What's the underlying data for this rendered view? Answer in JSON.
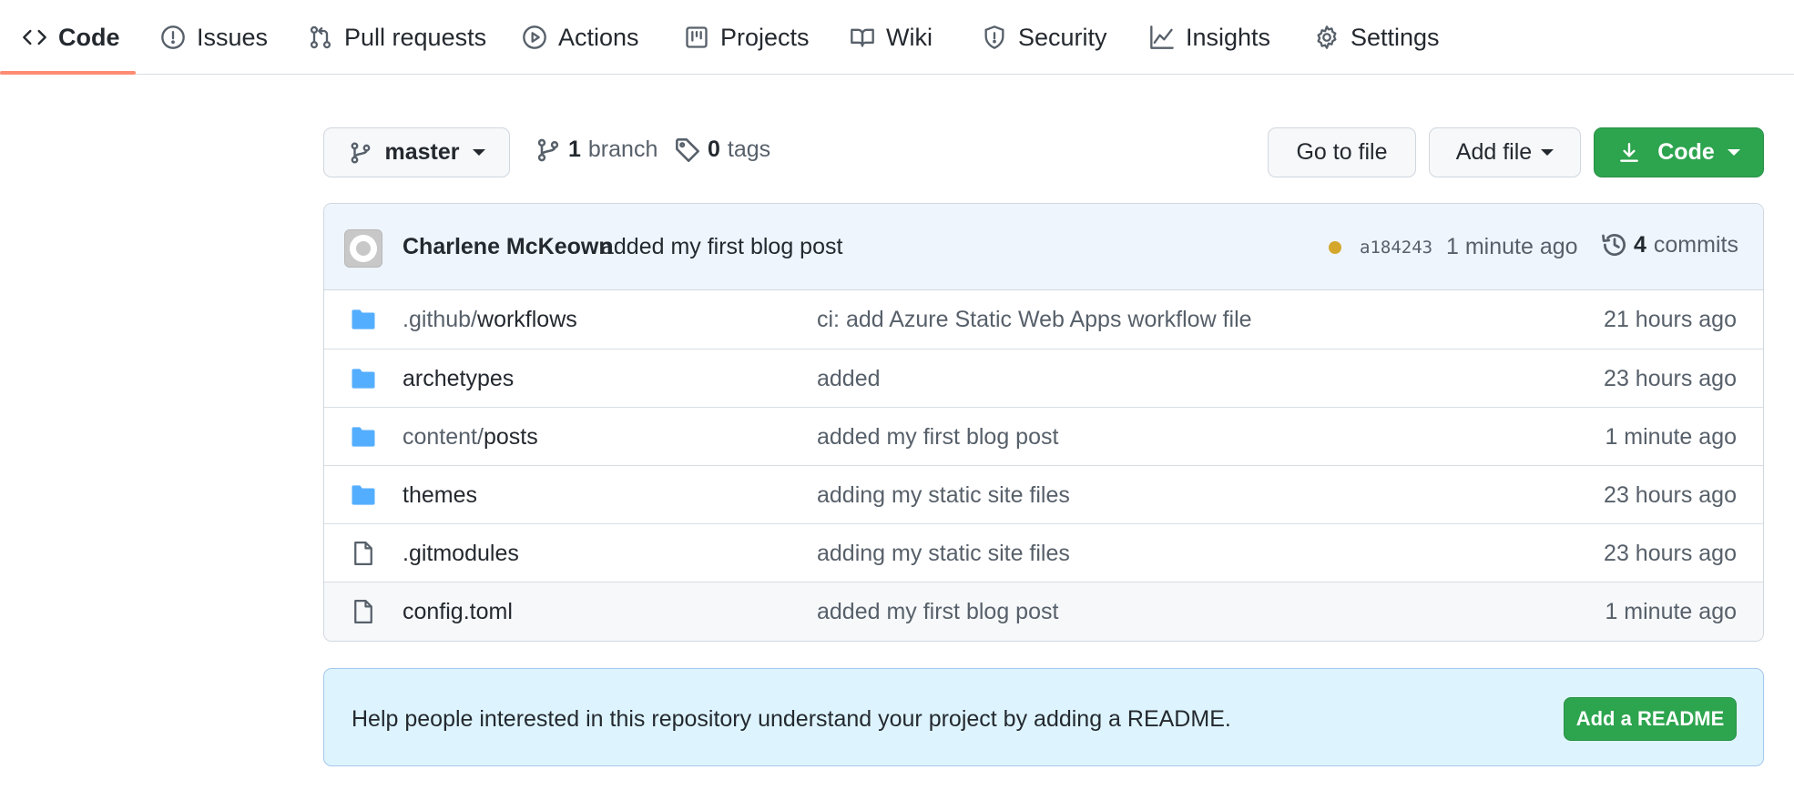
{
  "nav": {
    "tabs": [
      {
        "label": "Code",
        "icon": "code-icon",
        "active": true
      },
      {
        "label": "Issues",
        "icon": "issue-icon"
      },
      {
        "label": "Pull requests",
        "icon": "pull-request-icon"
      },
      {
        "label": "Actions",
        "icon": "play-icon"
      },
      {
        "label": "Projects",
        "icon": "project-icon"
      },
      {
        "label": "Wiki",
        "icon": "book-icon"
      },
      {
        "label": "Security",
        "icon": "shield-icon"
      },
      {
        "label": "Insights",
        "icon": "graph-icon"
      },
      {
        "label": "Settings",
        "icon": "gear-icon"
      }
    ]
  },
  "toolbar": {
    "branch_selector": "master",
    "branch_count": "1",
    "branch_label": "branch",
    "tag_count": "0",
    "tag_label": "tags",
    "go_to_file": "Go to file",
    "add_file": "Add file",
    "code_button": "Code"
  },
  "commit": {
    "author": "Charlene McKeown",
    "message": "added my first blog post",
    "status_color": "#d4a72c",
    "sha": "a184243",
    "time": "1 minute ago",
    "commit_count": "4",
    "commit_label": "commits"
  },
  "files": [
    {
      "type": "dir",
      "prefix": ".github/",
      "name": "workflows",
      "message": "ci: add Azure Static Web Apps workflow file",
      "age": "21 hours ago"
    },
    {
      "type": "dir",
      "prefix": "",
      "name": "archetypes",
      "message": "added",
      "age": "23 hours ago"
    },
    {
      "type": "dir",
      "prefix": "content/",
      "name": "posts",
      "message": "added my first blog post",
      "age": "1 minute ago"
    },
    {
      "type": "dir",
      "prefix": "",
      "name": "themes",
      "message": "adding my static site files",
      "age": "23 hours ago"
    },
    {
      "type": "file",
      "prefix": "",
      "name": ".gitmodules",
      "message": "adding my static site files",
      "age": "23 hours ago"
    },
    {
      "type": "file",
      "prefix": "",
      "name": "config.toml",
      "message": "added my first blog post",
      "age": "1 minute ago"
    }
  ],
  "readme_banner": {
    "text": "Help people interested in this repository understand your project by adding a README.",
    "button": "Add a README"
  },
  "colors": {
    "accent_underline": "#fd8c73",
    "primary_green": "#2da44e",
    "folder_blue": "#54aeff"
  }
}
